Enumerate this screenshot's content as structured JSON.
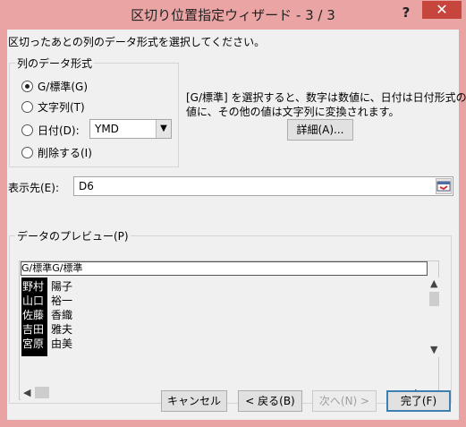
{
  "window": {
    "title": "区切り位置指定ウィザード - 3 / 3",
    "help_glyph": "?",
    "close_glyph": "✕"
  },
  "instructions": "区切ったあとの列のデータ形式を選択してください。",
  "format_group": {
    "legend": "列のデータ形式",
    "options": [
      {
        "label": "G/標準(G)",
        "selected": true
      },
      {
        "label": "文字列(T)",
        "selected": false
      },
      {
        "label": "日付(D):",
        "selected": false
      },
      {
        "label": "削除する(I)",
        "selected": false
      }
    ],
    "date_format": "YMD"
  },
  "description": {
    "line1": "[G/標準] を選択すると、数字は数値に、日付は日付形式の",
    "line2": "値に、その他の値は文字列に変換されます。"
  },
  "advanced_button": "詳細(A)...",
  "destination": {
    "label": "表示先(E):",
    "value": "D6"
  },
  "preview": {
    "legend": "データのプレビュー(P)",
    "header": "G/標準G/標準",
    "rows": [
      {
        "col1": "野村",
        "col2": "陽子"
      },
      {
        "col1": "山口",
        "col2": "裕一"
      },
      {
        "col1": "佐藤",
        "col2": "香織"
      },
      {
        "col1": "吉田",
        "col2": "雅夫"
      },
      {
        "col1": "宮原",
        "col2": "由美"
      }
    ]
  },
  "buttons": {
    "cancel": "キャンセル",
    "back": "< 戻る(B)",
    "next": "次へ(N) >",
    "finish": "完了(F)"
  }
}
